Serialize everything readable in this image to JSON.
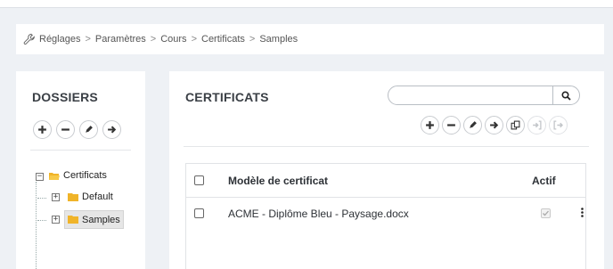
{
  "breadcrumb": {
    "icon": "wrench-icon",
    "items": [
      "Réglages",
      "Paramètres",
      "Cours",
      "Certificats",
      "Samples"
    ],
    "separator": ">"
  },
  "left_panel": {
    "title": "DOSSIERS",
    "toolbar": [
      {
        "name": "add-folder-button",
        "icon": "plus-icon"
      },
      {
        "name": "remove-folder-button",
        "icon": "minus-icon"
      },
      {
        "name": "rename-folder-button",
        "icon": "pencil-icon"
      },
      {
        "name": "move-folder-button",
        "icon": "arrow-right-icon"
      }
    ],
    "tree": {
      "root": {
        "label": "Certificats",
        "expanded": true
      },
      "children": [
        {
          "label": "Default",
          "selected": false
        },
        {
          "label": "Samples",
          "selected": true
        }
      ]
    }
  },
  "right_panel": {
    "title": "CERTIFICATS",
    "search": {
      "placeholder": "",
      "value": "",
      "icon": "search-icon"
    },
    "toolbar": [
      {
        "name": "add-certificate-button",
        "icon": "plus-icon",
        "enabled": true
      },
      {
        "name": "remove-certificate-button",
        "icon": "minus-icon",
        "enabled": true
      },
      {
        "name": "edit-certificate-button",
        "icon": "pencil-icon",
        "enabled": true
      },
      {
        "name": "move-certificate-button",
        "icon": "arrow-right-icon",
        "enabled": true
      },
      {
        "name": "duplicate-certificate-button",
        "icon": "copy-icon",
        "enabled": true
      },
      {
        "name": "import-certificate-button",
        "icon": "sign-in-icon",
        "enabled": false
      },
      {
        "name": "export-certificate-button",
        "icon": "sign-out-icon",
        "enabled": false
      }
    ],
    "table": {
      "columns": {
        "name": "Modèle de certificat",
        "active": "Actif"
      },
      "rows": [
        {
          "name": "ACME - Diplôme Bleu - Paysage.docx",
          "active": true
        }
      ]
    }
  },
  "colors": {
    "page_bg": "#eef1f5",
    "panel_bg": "#ffffff",
    "folder": "#f0b429",
    "title": "#3a3f45"
  }
}
